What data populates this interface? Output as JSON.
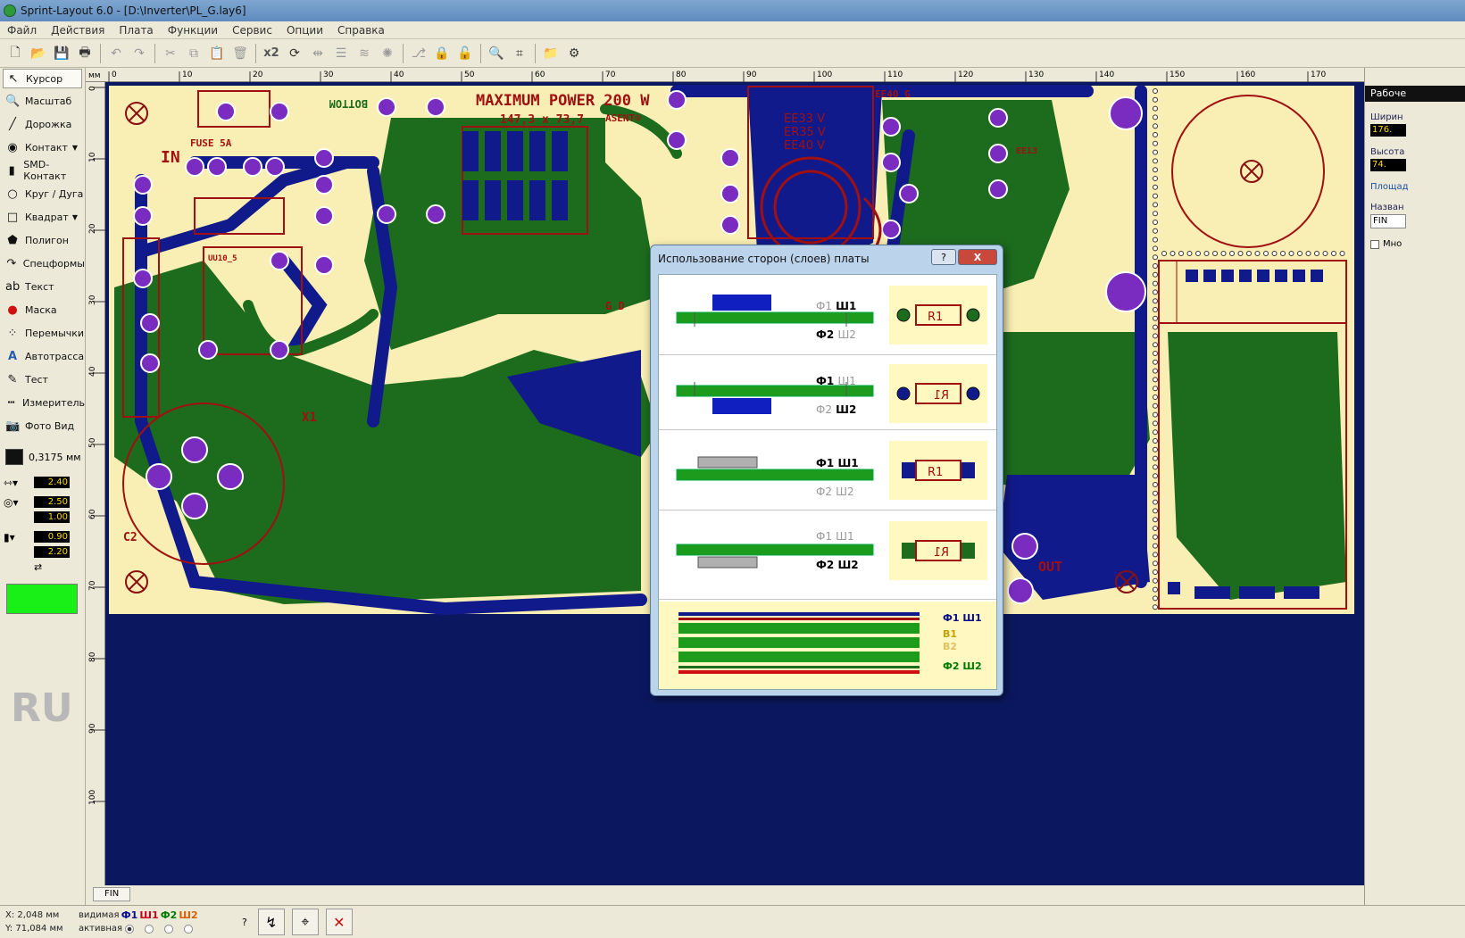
{
  "window": {
    "title": "Sprint-Layout 6.0 - [D:\\Inverter\\PL_G.lay6]"
  },
  "menu": [
    "Файл",
    "Действия",
    "Плата",
    "Функции",
    "Сервис",
    "Опции",
    "Справка"
  ],
  "toolbar": {
    "x2_label": "x2"
  },
  "tools": [
    {
      "label": "Курсор",
      "icon": "cursor-icon",
      "active": true
    },
    {
      "label": "Масштаб",
      "icon": "zoom-icon"
    },
    {
      "label": "Дорожка",
      "icon": "track-icon"
    },
    {
      "label": "Контакт",
      "icon": "pad-icon",
      "dropdown": true
    },
    {
      "label": "SMD-Контакт",
      "icon": "smd-pad-icon"
    },
    {
      "label": "Круг / Дуга",
      "icon": "circle-icon"
    },
    {
      "label": "Квадрат",
      "icon": "square-icon",
      "dropdown": true
    },
    {
      "label": "Полигон",
      "icon": "polygon-icon"
    },
    {
      "label": "Спецформы",
      "icon": "special-forms-icon"
    },
    {
      "label": "Текст",
      "icon": "text-icon"
    },
    {
      "label": "Маска",
      "icon": "mask-icon"
    },
    {
      "label": "Перемычки",
      "icon": "jumper-icon"
    },
    {
      "label": "Автотрасса",
      "icon": "autoroute-icon"
    },
    {
      "label": "Тест",
      "icon": "test-icon"
    },
    {
      "label": "Измеритель",
      "icon": "measure-icon"
    },
    {
      "label": "Фото Вид",
      "icon": "photo-view-icon"
    }
  ],
  "grid": {
    "value": "0,3175 мм"
  },
  "track_width": "2.40",
  "pad_outer": "2.50",
  "pad_inner": "1.00",
  "smd_w": "0.90",
  "smd_h": "2.20",
  "language": "RU",
  "ruler": {
    "unit": "мм",
    "top_ticks": [
      "0",
      "10",
      "20",
      "30",
      "40",
      "50",
      "60",
      "70",
      "80",
      "90",
      "100",
      "110",
      "120",
      "130",
      "140",
      "150",
      "160",
      "170"
    ],
    "left_ticks": [
      "0",
      "10",
      "20",
      "30",
      "40",
      "50",
      "60",
      "70",
      "80",
      "90",
      "100"
    ]
  },
  "board": {
    "title": "MAXIMUM POWER 200 W",
    "size": "147,3 x 73,7",
    "brand": "ASENT®",
    "bottom_label": "BOTTOM",
    "fuse": "FUSE 5A",
    "in": "IN",
    "x1": "X1",
    "c2": "C2",
    "out": "OUT",
    "uu": "UU10_5",
    "transformer": [
      "EE33 V",
      "ER35 V",
      "EE40 V"
    ],
    "ee40": "EE40 G",
    "ee13": "EE13",
    "gd": "G D"
  },
  "right_panel": {
    "header": "Рабоче",
    "width_label": "Ширин",
    "width_value": "176.",
    "height_label": "Высота",
    "height_value": "74.",
    "area_label": "Площад",
    "name_label": "Назван",
    "name_value": "FIN",
    "multi_label": "Мно"
  },
  "tab": {
    "label": "FIN"
  },
  "status": {
    "x_label": "X:",
    "x_value": "2,048 мм",
    "y_label": "Y:",
    "y_value": "71,084 мм",
    "visible_label": "видимая",
    "active_label": "активная",
    "layers": [
      "Ф1",
      "Ш1",
      "Ф2",
      "Ш2"
    ],
    "help": "?"
  },
  "dialog": {
    "title": "Использование сторон (слоев) платы",
    "help": "?",
    "close": "X",
    "rows": [
      {
        "f1": "Ф1",
        "s1": "Ш1",
        "f2": "Ф2",
        "s2": "Ш2",
        "part": "R1"
      },
      {
        "f1": "Ф1",
        "s1": "Ш1",
        "f2": "Ф2",
        "s2": "Ш2",
        "part": "R1"
      },
      {
        "f1": "Ф1",
        "s1": "Ш1",
        "f2": "Ф2",
        "s2": "Ш2",
        "part": "R1"
      },
      {
        "f1": "Ф1",
        "s1": "Ш1",
        "f2": "Ф2",
        "s2": "Ш2",
        "part": "R1"
      }
    ],
    "stack": {
      "top": "Ф1 Ш1",
      "b1": "B1",
      "b2": "B2",
      "bottom": "Ф2 Ш2"
    }
  }
}
